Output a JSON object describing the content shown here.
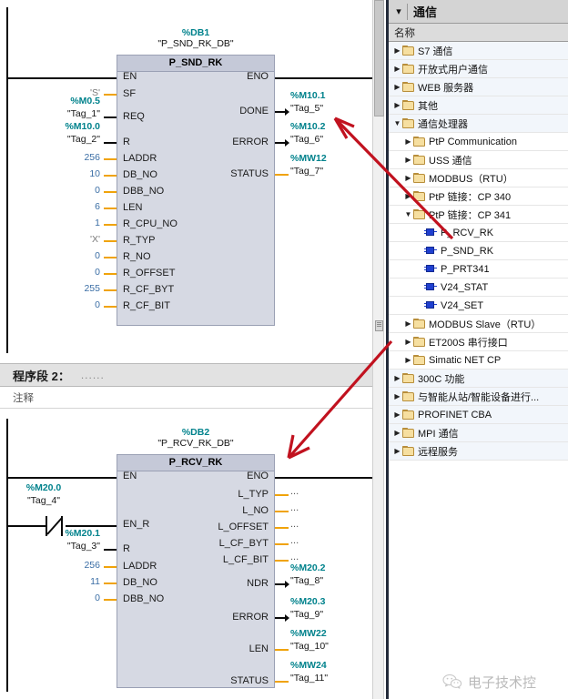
{
  "editor": {
    "network1": {
      "block": {
        "db_addr": "%DB1",
        "db_name": "\"P_SND_RK_DB\"",
        "title": "P_SND_RK",
        "inputs": [
          {
            "pin": "EN",
            "addr": "",
            "tag": "",
            "const": "",
            "wire": "black"
          },
          {
            "pin": "SF",
            "addr": "",
            "tag": "",
            "const": "'S'",
            "wire": "orange"
          },
          {
            "pin": "REQ",
            "addr": "%M0.5",
            "tag": "\"Tag_1\"",
            "const": "",
            "wire": "black"
          },
          {
            "pin": "R",
            "addr": "%M10.0",
            "tag": "\"Tag_2\"",
            "const": "",
            "wire": "black"
          },
          {
            "pin": "LADDR",
            "addr": "",
            "tag": "",
            "const": "256",
            "wire": "orange"
          },
          {
            "pin": "DB_NO",
            "addr": "",
            "tag": "",
            "const": "10",
            "wire": "orange"
          },
          {
            "pin": "DBB_NO",
            "addr": "",
            "tag": "",
            "const": "0",
            "wire": "orange"
          },
          {
            "pin": "LEN",
            "addr": "",
            "tag": "",
            "const": "6",
            "wire": "orange"
          },
          {
            "pin": "R_CPU_NO",
            "addr": "",
            "tag": "",
            "const": "1",
            "wire": "orange"
          },
          {
            "pin": "R_TYP",
            "addr": "",
            "tag": "",
            "const": "'X'",
            "wire": "orange"
          },
          {
            "pin": "R_NO",
            "addr": "",
            "tag": "",
            "const": "0",
            "wire": "orange"
          },
          {
            "pin": "R_OFFSET",
            "addr": "",
            "tag": "",
            "const": "0",
            "wire": "orange"
          },
          {
            "pin": "R_CF_BYT",
            "addr": "",
            "tag": "",
            "const": "255",
            "wire": "orange"
          },
          {
            "pin": "R_CF_BIT",
            "addr": "",
            "tag": "",
            "const": "0",
            "wire": "orange"
          }
        ],
        "outputs": [
          {
            "pin": "ENO",
            "addr": "",
            "tag": "",
            "wire": "black"
          },
          {
            "pin": "DONE",
            "addr": "%M10.1",
            "tag": "\"Tag_5\"",
            "wire": "bool"
          },
          {
            "pin": "ERROR",
            "addr": "%M10.2",
            "tag": "\"Tag_6\"",
            "wire": "bool"
          },
          {
            "pin": "STATUS",
            "addr": "%MW12",
            "tag": "\"Tag_7\"",
            "wire": "orange"
          }
        ]
      }
    },
    "network2": {
      "header_title": "程序段 2：",
      "header_dots": "......",
      "comment": "注释",
      "contact": {
        "addr": "%M20.0",
        "tag": "\"Tag_4\"",
        "type": "NC"
      },
      "block": {
        "db_addr": "%DB2",
        "db_name": "\"P_RCV_RK_DB\"",
        "title": "P_RCV_RK",
        "inputs": [
          {
            "pin": "EN",
            "addr": "",
            "tag": "",
            "const": "",
            "wire": "black"
          },
          {
            "pin": "EN_R",
            "addr": "",
            "tag": "",
            "const": "",
            "wire": "black"
          },
          {
            "pin": "R",
            "addr": "%M20.1",
            "tag": "\"Tag_3\"",
            "const": "",
            "wire": "black"
          },
          {
            "pin": "LADDR",
            "addr": "",
            "tag": "",
            "const": "256",
            "wire": "orange"
          },
          {
            "pin": "DB_NO",
            "addr": "",
            "tag": "",
            "const": "11",
            "wire": "orange"
          },
          {
            "pin": "DBB_NO",
            "addr": "",
            "tag": "",
            "const": "0",
            "wire": "orange"
          }
        ],
        "outputs": [
          {
            "pin": "ENO",
            "addr": "",
            "tag": "",
            "wire": "black"
          },
          {
            "pin": "L_TYP",
            "addr": "",
            "tag": "...",
            "wire": "orange"
          },
          {
            "pin": "L_NO",
            "addr": "",
            "tag": "...",
            "wire": "orange"
          },
          {
            "pin": "L_OFFSET",
            "addr": "",
            "tag": "...",
            "wire": "orange"
          },
          {
            "pin": "L_CF_BYT",
            "addr": "",
            "tag": "...",
            "wire": "orange"
          },
          {
            "pin": "L_CF_BIT",
            "addr": "",
            "tag": "...",
            "wire": "orange"
          },
          {
            "pin": "NDR",
            "addr": "%M20.2",
            "tag": "\"Tag_8\"",
            "wire": "bool"
          },
          {
            "pin": "ERROR",
            "addr": "%M20.3",
            "tag": "\"Tag_9\"",
            "wire": "bool"
          },
          {
            "pin": "LEN",
            "addr": "%MW22",
            "tag": "\"Tag_10\"",
            "wire": "orange"
          },
          {
            "pin": "STATUS",
            "addr": "%MW24",
            "tag": "\"Tag_11\"",
            "wire": "orange"
          }
        ]
      }
    }
  },
  "tree": {
    "header_title": "通信",
    "column_header": "名称",
    "rows": [
      {
        "label": "S7 通信",
        "indent": 0,
        "icon": "folder",
        "expander": "collapsed"
      },
      {
        "label": "开放式用户通信",
        "indent": 0,
        "icon": "folder",
        "expander": "collapsed"
      },
      {
        "label": "WEB 服务器",
        "indent": 0,
        "icon": "folder",
        "expander": "collapsed"
      },
      {
        "label": "其他",
        "indent": 0,
        "icon": "folder",
        "expander": "collapsed"
      },
      {
        "label": "通信处理器",
        "indent": 0,
        "icon": "folder",
        "expander": "expanded"
      },
      {
        "label": "PtP Communication",
        "indent": 1,
        "icon": "folder",
        "expander": "collapsed"
      },
      {
        "label": "USS 通信",
        "indent": 1,
        "icon": "folder",
        "expander": "collapsed"
      },
      {
        "label": "MODBUS（RTU）",
        "indent": 1,
        "icon": "folder",
        "expander": "collapsed"
      },
      {
        "label": "PtP 链接：CP 340",
        "indent": 1,
        "icon": "folder",
        "expander": "collapsed"
      },
      {
        "label": "PtP 链接：CP 341",
        "indent": 1,
        "icon": "folder",
        "expander": "expanded"
      },
      {
        "label": "P_RCV_RK",
        "indent": 2,
        "icon": "block",
        "expander": "none"
      },
      {
        "label": "P_SND_RK",
        "indent": 2,
        "icon": "block",
        "expander": "none"
      },
      {
        "label": "P_PRT341",
        "indent": 2,
        "icon": "block",
        "expander": "none"
      },
      {
        "label": "V24_STAT",
        "indent": 2,
        "icon": "block",
        "expander": "none"
      },
      {
        "label": "V24_SET",
        "indent": 2,
        "icon": "block",
        "expander": "none"
      },
      {
        "label": "MODBUS Slave（RTU）",
        "indent": 1,
        "icon": "folder",
        "expander": "collapsed"
      },
      {
        "label": "ET200S 串行接口",
        "indent": 1,
        "icon": "folder",
        "expander": "collapsed"
      },
      {
        "label": "Simatic NET CP",
        "indent": 1,
        "icon": "folder",
        "expander": "collapsed"
      },
      {
        "label": "300C 功能",
        "indent": 0,
        "icon": "folder",
        "expander": "collapsed"
      },
      {
        "label": "与智能从站/智能设备进行...",
        "indent": 0,
        "icon": "folder",
        "expander": "collapsed"
      },
      {
        "label": "PROFINET CBA",
        "indent": 0,
        "icon": "folder",
        "expander": "collapsed"
      },
      {
        "label": "MPI 通信",
        "indent": 0,
        "icon": "folder",
        "expander": "collapsed"
      },
      {
        "label": "远程服务",
        "indent": 0,
        "icon": "folder",
        "expander": "collapsed"
      }
    ]
  },
  "annotations": {
    "arrow_color": "#c1121f",
    "arrow1_label": "arrow-to-send-outputs",
    "arrow2_label": "arrow-to-recv-block"
  },
  "watermark": {
    "text": "电子技术控"
  }
}
